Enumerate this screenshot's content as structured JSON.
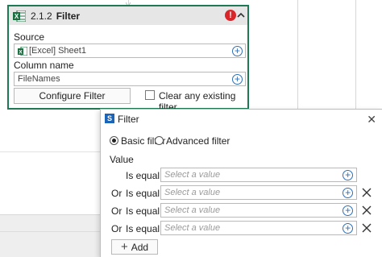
{
  "activity": {
    "step": "2.1.2",
    "title": "Filter",
    "error_glyph": "!",
    "source_label": "Source",
    "source_value": "[Excel] Sheet1",
    "column_label": "Column name",
    "column_value": "FileNames",
    "configure_label": "Configure Filter",
    "clear_filter_label": "Clear any existing filter",
    "clear_filter_checked": false,
    "border_color": "#1e7a55"
  },
  "dialog": {
    "title": "Filter",
    "icon_glyph": "S",
    "basic_label": "Basic filter",
    "advanced_label": "Advanced filter",
    "selected_mode": "basic",
    "value_label": "Value",
    "rows": [
      {
        "prefix": "",
        "operator": "Is equal to",
        "placeholder": "Select a value",
        "removable": false
      },
      {
        "prefix": "Or",
        "operator": "Is equal to",
        "placeholder": "Select a value",
        "removable": true
      },
      {
        "prefix": "Or",
        "operator": "Is equal to",
        "placeholder": "Select a value",
        "removable": true
      },
      {
        "prefix": "Or",
        "operator": "Is equal to",
        "placeholder": "Select a value",
        "removable": true
      }
    ],
    "add_label": "Add",
    "close_glyph": "✕"
  }
}
